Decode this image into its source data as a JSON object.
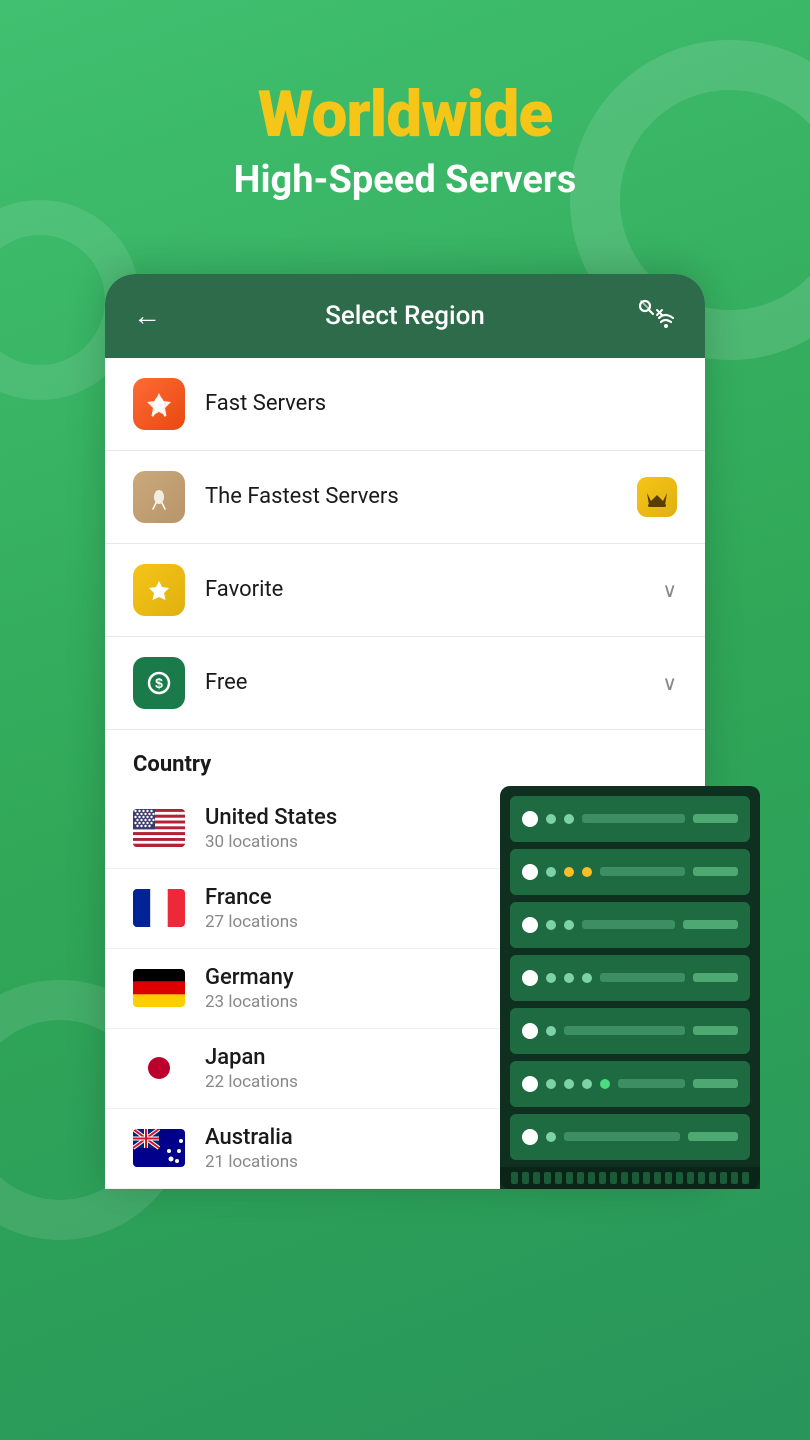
{
  "header": {
    "title": "Worldwide",
    "subtitle": "High-Speed Servers"
  },
  "card": {
    "back_label": "←",
    "title": "Select Region",
    "menu_items": [
      {
        "id": "fast-servers",
        "label": "Fast Servers",
        "icon_type": "orange",
        "icon_char": "🚀",
        "has_badge": false,
        "has_chevron": false
      },
      {
        "id": "fastest-servers",
        "label": "The Fastest Servers",
        "icon_type": "tan",
        "icon_char": "🚀",
        "has_badge": true,
        "badge_char": "👑",
        "has_chevron": false
      },
      {
        "id": "favorite",
        "label": "Favorite",
        "icon_type": "yellow",
        "icon_char": "⭐",
        "has_badge": false,
        "has_chevron": true
      },
      {
        "id": "free",
        "label": "Free",
        "icon_type": "green",
        "icon_char": "$",
        "has_badge": false,
        "has_chevron": true
      }
    ],
    "country_section_label": "Country",
    "countries": [
      {
        "id": "us",
        "name": "United States",
        "locations": "30 locations",
        "flag": "us"
      },
      {
        "id": "fr",
        "name": "France",
        "locations": "27 locations",
        "flag": "fr"
      },
      {
        "id": "de",
        "name": "Germany",
        "locations": "23 locations",
        "flag": "de"
      },
      {
        "id": "jp",
        "name": "Japan",
        "locations": "22 locations",
        "flag": "jp"
      },
      {
        "id": "au",
        "name": "Australia",
        "locations": "21 locations",
        "flag": "au"
      }
    ]
  }
}
